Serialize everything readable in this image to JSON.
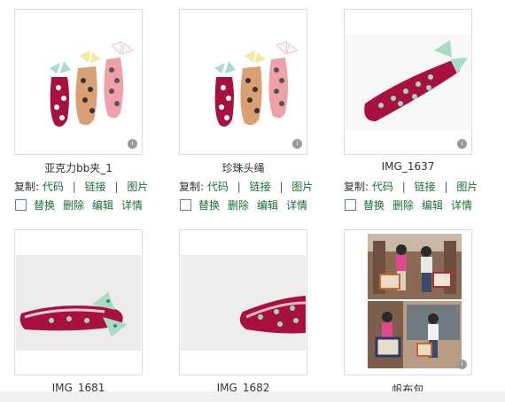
{
  "items": [
    {
      "name": "亚克力bb夹_1",
      "photo": "three polka-dot hair clips with bows"
    },
    {
      "name": "珍珠头绳",
      "photo": "three polka-dot hair clips with bows"
    },
    {
      "name": "IMG_1637",
      "photo": "single polka-dot hair clip"
    },
    {
      "name": "IMG_1681",
      "photo": "hair clip close-up"
    },
    {
      "name": "IMG_1682",
      "photo": "hair clip side view"
    },
    {
      "name": "帆布包",
      "photo": "couple with canvas bags collage"
    }
  ],
  "links": {
    "prefix": "复制:",
    "code": "代码",
    "link": "链接",
    "image": "图片",
    "sep": "|"
  },
  "actions": {
    "replace": "替换",
    "delete": "删除",
    "edit": "编辑",
    "detail": "详情"
  },
  "badge_icon": "info-icon"
}
